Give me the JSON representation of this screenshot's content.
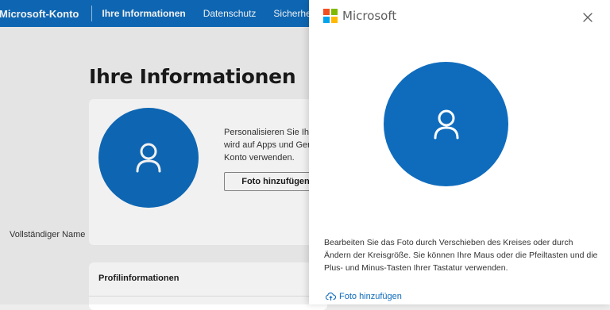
{
  "nav": {
    "brand": "Microsoft-Konto",
    "links": [
      "Ihre Informationen",
      "Datenschutz",
      "Sicherheit"
    ]
  },
  "page": {
    "title": "Ihre Informationen",
    "card": {
      "description_lines": [
        "Personalisieren Sie Ihr",
        "wird auf Apps und Ger",
        "Konto verwenden."
      ],
      "button": "Foto hinzufügen",
      "name_label": "Vollständiger Name"
    },
    "profile_title": "Profilinformationen"
  },
  "modal": {
    "brand": "Microsoft",
    "description": "Bearbeiten Sie das Foto durch Verschieben des Kreises oder durch Ändern der Kreisgröße. Sie können Ihre Maus oder die Pfeiltasten und die Plus- und Minus-Tasten Ihrer Tastatur verwenden.",
    "link": "Foto hinzufügen"
  },
  "colors": {
    "accent": "#0f6cbd",
    "ms_red": "#f25022",
    "ms_green": "#7fba00",
    "ms_blue": "#00a4ef",
    "ms_yellow": "#ffb900"
  },
  "icons": [
    "person-icon",
    "close-icon",
    "upload-cloud-icon",
    "microsoft-logo-icon"
  ]
}
